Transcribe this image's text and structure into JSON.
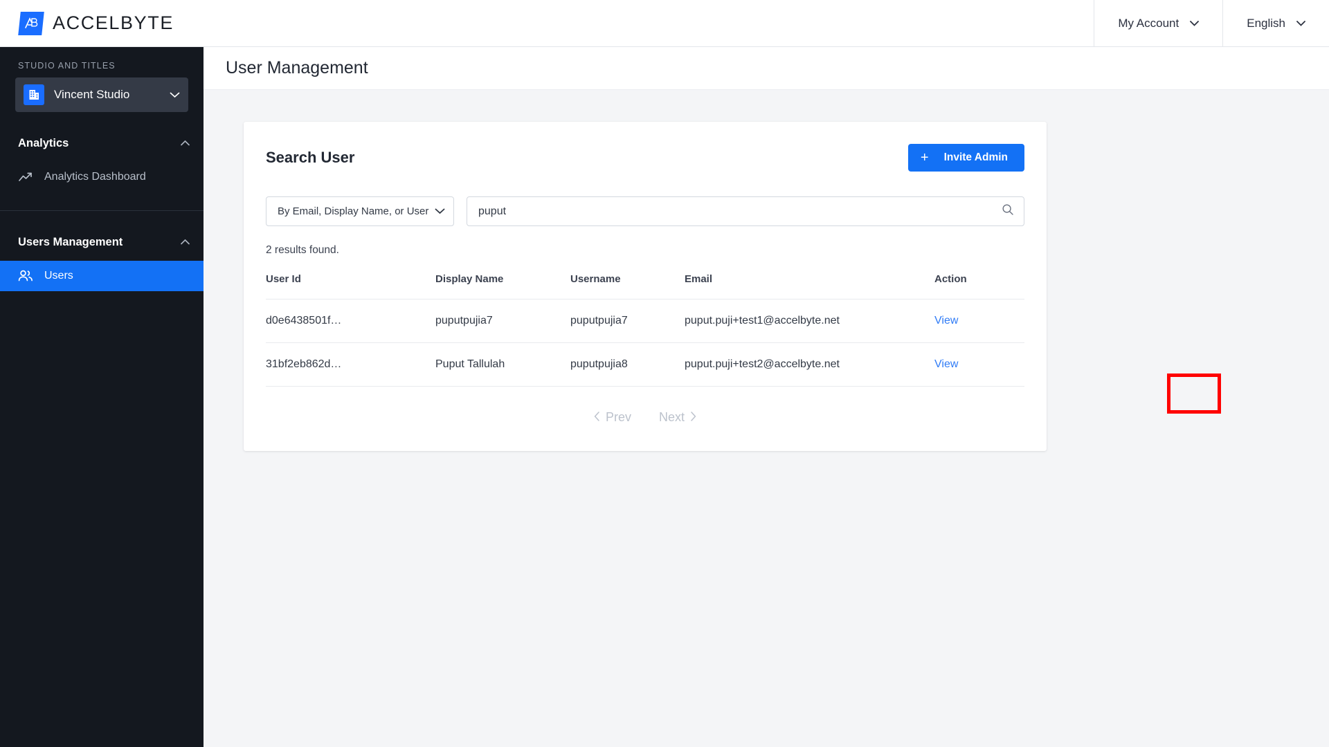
{
  "brand": {
    "badge_text": "AB",
    "name_bold": "ACCEL",
    "name_light": "BYTE"
  },
  "topbar": {
    "account_label": "My Account",
    "language_label": "English"
  },
  "sidebar": {
    "studio_label": "STUDIO AND TITLES",
    "studio_name": "Vincent Studio",
    "sections": [
      {
        "title": "Analytics",
        "items": [
          {
            "label": "Analytics Dashboard",
            "icon": "trending-up-icon",
            "active": false
          }
        ]
      },
      {
        "title": "Users Management",
        "items": [
          {
            "label": "Users",
            "icon": "users-icon",
            "active": true
          }
        ]
      }
    ]
  },
  "page": {
    "title": "User Management"
  },
  "card": {
    "title": "Search User",
    "invite_button": "Invite Admin",
    "invite_icon": "plus-icon",
    "filter_selected": "By Email, Display Name, or User Na…",
    "search_value": "puput",
    "search_placeholder": "",
    "search_icon": "search-icon",
    "results_text": "2 results found.",
    "columns": [
      "User Id",
      "Display Name",
      "Username",
      "Email",
      "Action"
    ],
    "rows": [
      {
        "user_id": "d0e6438501f…",
        "display_name": "puputpujia7",
        "username": "puputpujia7",
        "email": "puput.puji+test1@accelbyte.net",
        "action": "View"
      },
      {
        "user_id": "31bf2eb862d…",
        "display_name": "Puput Tallulah",
        "username": "puputpujia8",
        "email": "puput.puji+test2@accelbyte.net",
        "action": "View"
      }
    ],
    "pagination": {
      "prev": "Prev",
      "next": "Next"
    }
  },
  "colors": {
    "accent_blue": "#1371f5",
    "link_blue": "#2f7bf6",
    "sidebar_bg": "#14181f",
    "annotation_red": "#ff0000"
  }
}
